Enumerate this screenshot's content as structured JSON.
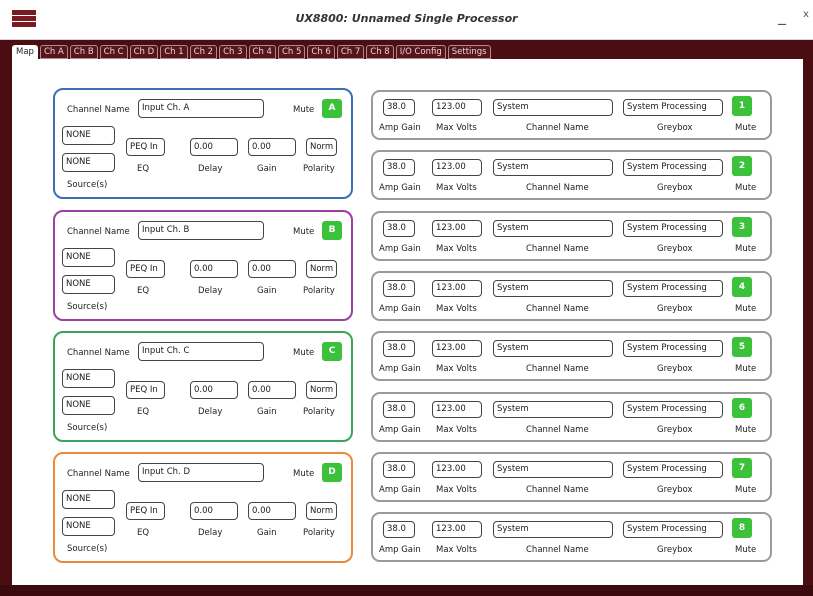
{
  "window": {
    "title": "UX8800: Unnamed Single Processor",
    "minimize_glyph": "_",
    "close_glyph": "x"
  },
  "tabs": [
    "Map",
    "Ch A",
    "Ch B",
    "Ch C",
    "Ch D",
    "Ch 1",
    "Ch 2",
    "Ch 3",
    "Ch 4",
    "Ch 5",
    "Ch 6",
    "Ch 7",
    "Ch 8",
    "I/O Config",
    "Settings"
  ],
  "active_tab": "Map",
  "input_labels": {
    "channel_name": "Channel Name",
    "mute": "Mute",
    "eq": "EQ",
    "delay": "Delay",
    "gain": "Gain",
    "polarity": "Polarity",
    "sources": "Source(s)"
  },
  "inputs": [
    {
      "channel_name": "Input Ch. A",
      "mute": "A",
      "source1": "NONE",
      "source2": "NONE",
      "eq": "PEQ In",
      "delay": "0.00",
      "gain": "0.00",
      "polarity": "Norm",
      "color": "#3d6fb6"
    },
    {
      "channel_name": "Input Ch. B",
      "mute": "B",
      "source1": "NONE",
      "source2": "NONE",
      "eq": "PEQ In",
      "delay": "0.00",
      "gain": "0.00",
      "polarity": "Norm",
      "color": "#9b3fa5"
    },
    {
      "channel_name": "Input Ch. C",
      "mute": "C",
      "source1": "NONE",
      "source2": "NONE",
      "eq": "PEQ In",
      "delay": "0.00",
      "gain": "0.00",
      "polarity": "Norm",
      "color": "#3aa45a"
    },
    {
      "channel_name": "Input Ch. D",
      "mute": "D",
      "source1": "NONE",
      "source2": "NONE",
      "eq": "PEQ In",
      "delay": "0.00",
      "gain": "0.00",
      "polarity": "Norm",
      "color": "#ea8a3c"
    }
  ],
  "output_labels": {
    "amp_gain": "Amp Gain",
    "max_volts": "Max Volts",
    "channel_name": "Channel Name",
    "greybox": "Greybox",
    "mute": "Mute"
  },
  "outputs": [
    {
      "amp_gain": "38.0",
      "max_volts": "123.00",
      "channel_name": "System",
      "greybox": "System Processing",
      "mute": "1"
    },
    {
      "amp_gain": "38.0",
      "max_volts": "123.00",
      "channel_name": "System",
      "greybox": "System Processing",
      "mute": "2"
    },
    {
      "amp_gain": "38.0",
      "max_volts": "123.00",
      "channel_name": "System",
      "greybox": "System Processing",
      "mute": "3"
    },
    {
      "amp_gain": "38.0",
      "max_volts": "123.00",
      "channel_name": "System",
      "greybox": "System Processing",
      "mute": "4"
    },
    {
      "amp_gain": "38.0",
      "max_volts": "123.00",
      "channel_name": "System",
      "greybox": "System Processing",
      "mute": "5"
    },
    {
      "amp_gain": "38.0",
      "max_volts": "123.00",
      "channel_name": "System",
      "greybox": "System Processing",
      "mute": "6"
    },
    {
      "amp_gain": "38.0",
      "max_volts": "123.00",
      "channel_name": "System",
      "greybox": "System Processing",
      "mute": "7"
    },
    {
      "amp_gain": "38.0",
      "max_volts": "123.00",
      "channel_name": "System",
      "greybox": "System Processing",
      "mute": "8"
    }
  ],
  "colors": {
    "mute_on": "#3cc23a",
    "frame": "#4a0e12",
    "output_border": "#9a9a9a"
  }
}
